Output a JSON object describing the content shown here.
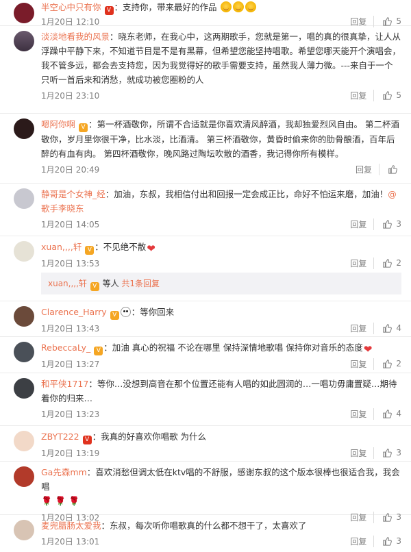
{
  "comments": [
    {
      "user": "半空心中只有你",
      "text": "：支持你，带来最好的作品",
      "date": "1月20日 12:10",
      "reply": "回复",
      "likes": "5",
      "avatar_color": "#7a1c2a"
    },
    {
      "user": "淡淡地看我的风景",
      "text": "：晓东老师，在我心中，这两期歌手，您就是第一，唱的真的很真挚，让人从浮躁中平静下来，不知道节目是不是有黑幕，但希望您能坚持唱歌。希望您哪天能开个演唱会，我不管多远，都会去支持您，因为我觉得好的歌手需要支持，虽然我人薄力微。---来自于一个只听一首后来和消愁，就成功被您圈粉的人",
      "date": "1月20日 23:10",
      "reply": "回复",
      "likes": "5",
      "avatar_color": "#5a4a5c"
    },
    {
      "user": "嗯阿你啊",
      "text": "：第一杯酒敬你，所谓不合适就是你喜欢清风醉酒，我却独爱烈风自由。 第二杯酒敬你，岁月里你很干净，比水淡，比酒清。 第三杯酒敬你，黄昏时偷来你的肋骨酿酒，百年后醉的有血有肉。 第四杯酒敬你，晚风路过陶坛吹散的酒香，我记得你所有模样。",
      "date": "1月20日 20:49",
      "reply": "回复",
      "likes": "",
      "avatar_color": "#2b1a1a"
    },
    {
      "user": "静哥是个女神_经",
      "text": "：加油，东叔，我相信付出和回报一定会成正比，命好不怕运来磨，加油！",
      "mention": "@歌手李晓东",
      "date": "1月20日 14:05",
      "reply": "回复",
      "likes": "3",
      "avatar_color": "#c8c8d0"
    },
    {
      "user": "xuan,,,,轩",
      "text": "：不见绝不散",
      "date": "1月20日 13:53",
      "reply": "回复",
      "likes": "2",
      "avatar_color": "#e6e2d6",
      "subreply": {
        "who": "xuan,,,,轩",
        "others": " 等人 ",
        "more": "共1条回复"
      }
    },
    {
      "user": "Clarence_Harry",
      "text": "：等你回来",
      "date": "1月20日 13:43",
      "reply": "回复",
      "likes": "4",
      "avatar_color": "#6b4a3a"
    },
    {
      "user": "RebeccaLy_",
      "text": "：加油 真心的祝福 不论在哪里 保持深情地歌唱 保持你对音乐的态度",
      "date": "1月20日 13:27",
      "reply": "回复",
      "likes": "2",
      "avatar_color": "#4a5058"
    },
    {
      "user": "和平侠1717",
      "text": "：等你…没想到高音在那个位置还能有人唱的如此圆润的…一唱功毋庸置疑…期待着你的归来…",
      "date": "1月20日 13:23",
      "reply": "回复",
      "likes": "4",
      "avatar_color": "#3c3f44"
    },
    {
      "user": "ZBYT222",
      "text": "：我真的好喜欢你唱歌 为什么",
      "date": "1月20日 13:19",
      "reply": "回复",
      "likes": "3",
      "avatar_color": "#f2d9c8"
    },
    {
      "user": "Ga先森mm",
      "text": "：喜欢消愁但调太低在ktv唱的不舒服，感谢东叔的这个版本很棒也很适合我，我会唱",
      "date": "1月20日 13:02",
      "reply": "回复",
      "likes": "3",
      "avatar_color": "#b23a2a"
    },
    {
      "user": "麦兜腊肠太爱我",
      "text": "：东叔，每次听你唱歌真的什么都不想干了，太喜欢了",
      "date": "1月20日 13:01",
      "reply": "回复",
      "likes": "3",
      "avatar_color": "#d8c4b4"
    }
  ],
  "icons": {
    "like": "thumbs-up-icon"
  },
  "colors": {
    "username": "#eb7350",
    "meta": "#808080",
    "text": "#333333"
  }
}
